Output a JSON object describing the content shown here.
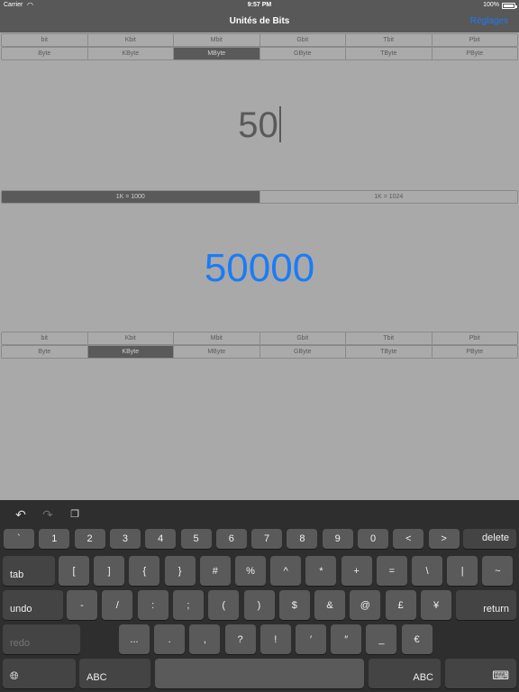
{
  "status": {
    "carrier": "Carrier",
    "time": "9:57 PM",
    "battery": "100%"
  },
  "nav": {
    "title": "Unités de Bits",
    "settings": "Réglages"
  },
  "input_bits": [
    "bit",
    "Kbit",
    "Mbit",
    "Gbit",
    "Tbit",
    "Pbit"
  ],
  "input_bytes": [
    "Byte",
    "KByte",
    "MByte",
    "GByte",
    "TByte",
    "PByte"
  ],
  "input_selected": "MByte",
  "input_value": "50",
  "base": {
    "options": [
      "1K = 1000",
      "1K = 1024"
    ],
    "selected": "1K = 1000"
  },
  "output_value": "50000",
  "output_bits": [
    "bit",
    "Kbit",
    "Mbit",
    "Gbit",
    "Tbit",
    "Pbit"
  ],
  "output_bytes": [
    "Byte",
    "KByte",
    "MByte",
    "GByte",
    "TByte",
    "PByte"
  ],
  "output_selected": "KByte",
  "keyboard": {
    "toolbar": {
      "undo": "undo-icon",
      "redo": "redo-icon",
      "paste": "paste-icon"
    },
    "row1": [
      "`",
      "1",
      "2",
      "3",
      "4",
      "5",
      "6",
      "7",
      "8",
      "9",
      "0",
      "<",
      ">"
    ],
    "delete": "delete",
    "tab": "tab",
    "row2": [
      "[",
      "]",
      "{",
      "}",
      "#",
      "%",
      "^",
      "*",
      "+",
      "=",
      "\\",
      "|",
      "~"
    ],
    "undo": "undo",
    "row3": [
      "-",
      "/",
      ":",
      ";",
      "(",
      ")",
      "$",
      "&",
      "@",
      "£",
      "¥"
    ],
    "return": "return",
    "redo": "redo",
    "row4": [
      "...",
      ".",
      ",",
      "?",
      "!",
      "′",
      "″",
      "_",
      "€"
    ],
    "globe": "globe-icon",
    "abc": "ABC",
    "hide": "keyboard-hide-icon"
  }
}
